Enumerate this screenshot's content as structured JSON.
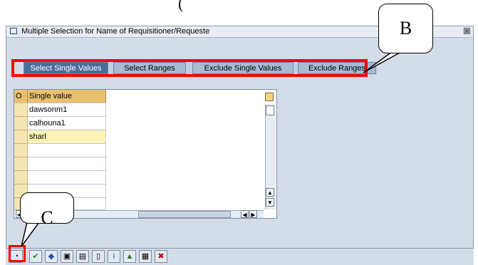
{
  "top_glyph": "(",
  "window": {
    "title": "Multiple Selection for Name of Requisitioner/Requeste",
    "close_symbol": "⊠"
  },
  "tabs": [
    {
      "label": "Select Single Values",
      "active": true
    },
    {
      "label": "Select Ranges",
      "active": false
    },
    {
      "label": "Exclude Single Values",
      "active": false
    },
    {
      "label": "Exclude Ranges",
      "active": false
    }
  ],
  "grid": {
    "header": {
      "option": "O",
      "single_value": "Single value"
    },
    "rows": [
      "dawsonm1",
      "calhouna1",
      "sharl",
      "",
      "",
      "",
      "",
      "",
      "",
      ""
    ]
  },
  "toolbar": {
    "icons": [
      "clock-icon",
      "check-icon",
      "multiselect-icon",
      "insert-row-icon",
      "delete-row-icon",
      "trash-icon",
      "info-icon",
      "upload-icon",
      "paste-icon",
      "cancel-icon"
    ]
  },
  "callouts": {
    "b": "B",
    "c": "C"
  },
  "colors": {
    "highlight": "#ff0000",
    "active_tab": "#496d9b",
    "header": "#e9c16e"
  }
}
